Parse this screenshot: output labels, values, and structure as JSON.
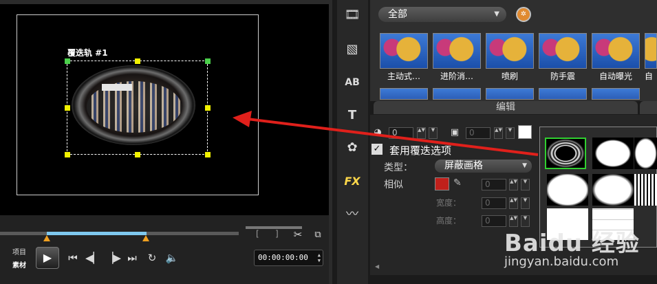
{
  "preview": {
    "track_label": "覆迭轨 #1",
    "project_label": "项目",
    "clip_label": "素材",
    "timecode": "00:00:00:00"
  },
  "icons": {
    "play": "play-icon",
    "loop": "repeat-icon",
    "volume": "speaker-icon"
  },
  "toolbar": {
    "fx_label": "FX",
    "text_label": "T",
    "title_label": "AB"
  },
  "gallery": {
    "category": "全部",
    "effects": [
      "主动式…",
      "进阶消…",
      "喷刷",
      "防手震",
      "自动曝光",
      "自"
    ]
  },
  "edit": {
    "tab_label": "编辑",
    "spin_value_1": "0",
    "spin_value_2": "0",
    "apply_overlay_label": "套用覆迭选项",
    "type_label": "类型：",
    "type_value": "屏蔽画格",
    "similar_label": "相似",
    "similar_value": "0",
    "width_label": "宽度：",
    "width_value": "0",
    "height_label": "高度：",
    "height_value": "0"
  },
  "colors": {
    "accent_selected_mask": "#30d030",
    "mask_color_swatch": "#c0201b",
    "arrow_annotation": "#e0201b"
  },
  "watermark": {
    "main": "Baidu 经验",
    "sub": "jingyan.baidu.com"
  }
}
